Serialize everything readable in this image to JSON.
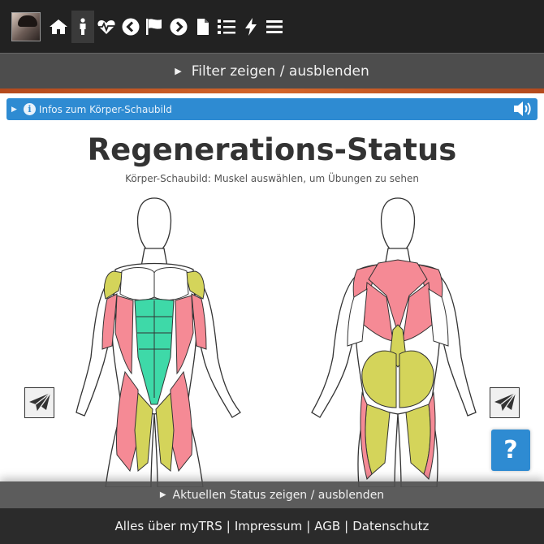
{
  "nav": {
    "icons": [
      "home-icon",
      "person-icon",
      "heartbeat-icon",
      "chevron-left-icon",
      "flag-icon",
      "chevron-right-icon",
      "file-icon",
      "list-icon",
      "bolt-icon",
      "menu-icon"
    ]
  },
  "filter": {
    "label": "Filter zeigen / ausblenden"
  },
  "info": {
    "label": "Infos zum Körper-Schaubild"
  },
  "page": {
    "title": "Regenerations-Status",
    "subtitle": "Körper-Schaubild: Muskel auswählen, um Übungen zu sehen"
  },
  "colors": {
    "recovered": "#f58a95",
    "partial": "#d4d45a",
    "fresh": "#3ed9a8",
    "accent": "#2e8bd2"
  },
  "help": {
    "label": "?"
  },
  "status": {
    "label": "Aktuellen Status zeigen / ausblenden"
  },
  "footer": {
    "links": [
      "Alles über myTRS",
      "Impressum",
      "AGB",
      "Datenschutz"
    ],
    "separator": "|"
  }
}
